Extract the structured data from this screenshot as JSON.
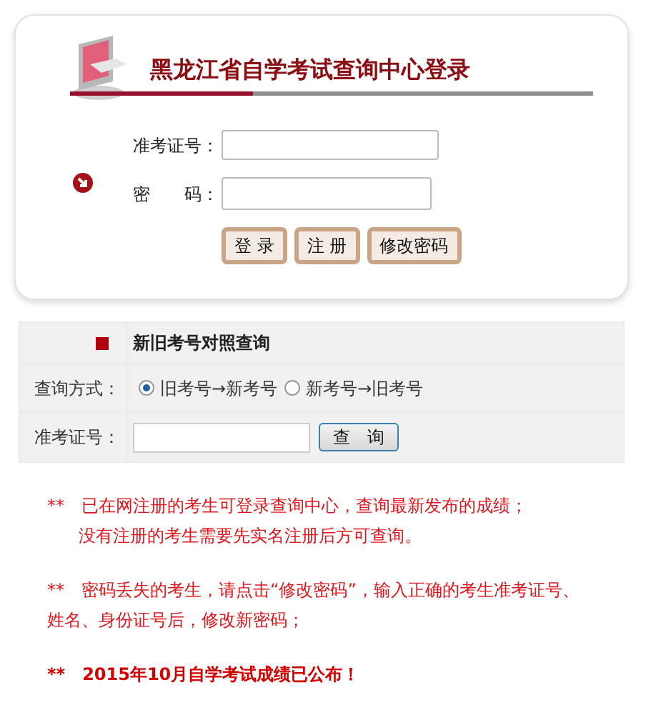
{
  "login": {
    "title": "黑龙江省自学考试查询中心登录",
    "fields": [
      {
        "label": "准考证号："
      },
      {
        "label": "密　　码："
      }
    ],
    "buttons": [
      "登 录",
      "注 册",
      "修改密码"
    ]
  },
  "lookup": {
    "heading": "新旧考号对照查询",
    "mode_label": "查询方式：",
    "modes": [
      {
        "label": "旧考号→新考号",
        "selected": true
      },
      {
        "label": "新考号→旧考号",
        "selected": false
      }
    ],
    "id_label": "准考证号：",
    "query_button": "查　询"
  },
  "notices": [
    {
      "mark": "**",
      "lines": [
        "已在网注册的考生可登录查询中心，查询最新发布的成绩；",
        "没有注册的考生需要先实名注册后方可查询。"
      ],
      "bold": false
    },
    {
      "mark": "**",
      "lines": [
        "密码丢失的考生，请点击“修改密码”，输入正确的考生准考证号、姓名、身份证号后，修改新密码；"
      ],
      "bold": false
    },
    {
      "mark": "**",
      "lines": [
        "2015年10月自学考试成绩已公布！"
      ],
      "bold": true
    }
  ]
}
